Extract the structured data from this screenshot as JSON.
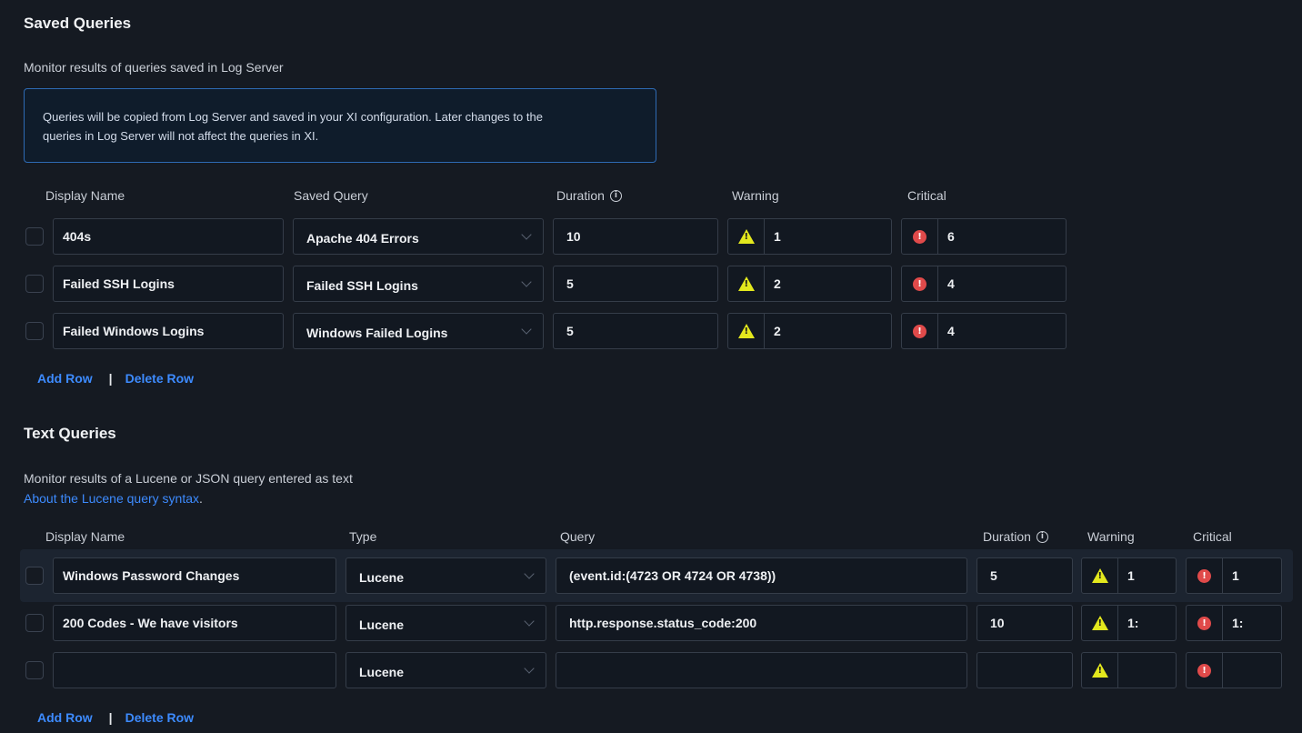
{
  "saved": {
    "title": "Saved Queries",
    "description": "Monitor results of queries saved in Log Server",
    "info_line1": "Queries will be copied from Log Server and saved in your XI configuration. Later changes to the",
    "info_line2": "queries in Log Server will not affect the queries in XI.",
    "headers": {
      "display_name": "Display Name",
      "saved_query": "Saved Query",
      "duration": "Duration",
      "warning": "Warning",
      "critical": "Critical"
    },
    "rows": [
      {
        "display_name": "404s",
        "saved_query": "Apache 404 Errors",
        "duration": "10",
        "warning": "1",
        "critical": "6"
      },
      {
        "display_name": "Failed SSH Logins",
        "saved_query": "Failed SSH Logins",
        "duration": "5",
        "warning": "2",
        "critical": "4"
      },
      {
        "display_name": "Failed Windows Logins",
        "saved_query": "Windows Failed Logins",
        "duration": "5",
        "warning": "2",
        "critical": "4"
      }
    ],
    "add_row": "Add Row",
    "separator": "|",
    "delete_row": "Delete Row"
  },
  "text": {
    "title": "Text Queries",
    "description": "Monitor results of a Lucene or JSON query entered as text",
    "syntax_link": "About the Lucene query syntax",
    "syntax_period": ".",
    "headers": {
      "display_name": "Display Name",
      "type": "Type",
      "query": "Query",
      "duration": "Duration",
      "warning": "Warning",
      "critical": "Critical"
    },
    "rows": [
      {
        "display_name": "Windows Password Changes",
        "type": "Lucene",
        "query": "(event.id:(4723 OR 4724 OR 4738))",
        "duration": "5",
        "warning": "1",
        "critical": "1"
      },
      {
        "display_name": "200 Codes - We have visitors",
        "type": "Lucene",
        "query": "http.response.status_code:200",
        "duration": "10",
        "warning": "1:",
        "critical": "1:"
      },
      {
        "display_name": "",
        "type": "Lucene",
        "query": "",
        "duration": "",
        "warning": "",
        "critical": ""
      }
    ],
    "add_row": "Add Row",
    "separator": "|",
    "delete_row": "Delete Row"
  },
  "icons": {
    "info": "info-circle-icon",
    "warning": "warning-triangle-icon",
    "critical": "critical-circle-icon",
    "dropdown": "chevron-down-icon"
  },
  "colors": {
    "background": "#151a22",
    "link": "#3d8bff",
    "info_border": "#2e6ab3",
    "warning": "#e3e81d",
    "critical": "#e04a4a"
  }
}
